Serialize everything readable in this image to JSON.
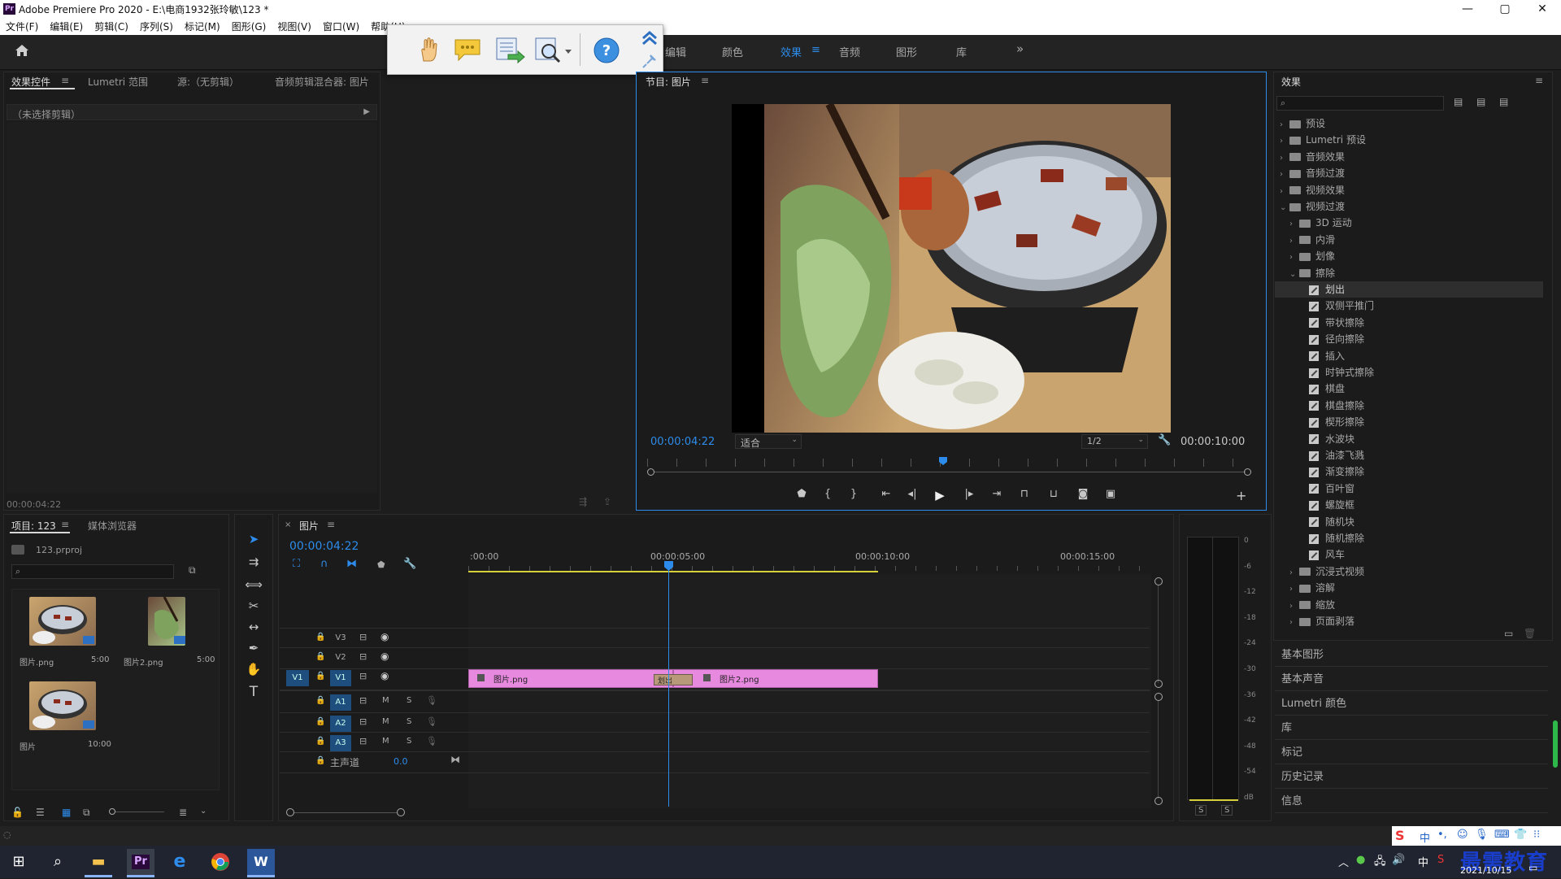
{
  "window": {
    "app_icon": "Pr",
    "title": "Adobe Premiere Pro 2020 - E:\\电商1932张玲敏\\123 *",
    "min": "—",
    "max": "▢",
    "close": "✕"
  },
  "menu": [
    "文件(F)",
    "编辑(E)",
    "剪辑(C)",
    "序列(S)",
    "标记(M)",
    "图形(G)",
    "视图(V)",
    "窗口(W)",
    "帮助(H)"
  ],
  "workspaces": [
    "编辑",
    "颜色",
    "效果",
    "音频",
    "图形",
    "库"
  ],
  "workspace_active": "效果",
  "workspace_more": "»",
  "effect_controls": {
    "tabs": [
      "效果控件",
      "Lumetri 范围",
      "源:（无剪辑）",
      "音频剪辑混合器: 图片"
    ],
    "no_clip": "（未选择剪辑）",
    "timecode": "00:00:04:22"
  },
  "program_monitor": {
    "title": "节目: 图片",
    "timecode": "00:00:04:22",
    "fit": "适合",
    "resolution": "1/2",
    "duration": "00:00:10:00",
    "playhead_fraction": 0.489
  },
  "project": {
    "tabs": [
      "项目: 123",
      "媒体浏览器"
    ],
    "file": "123.prproj",
    "items": [
      {
        "name": "图片.png",
        "duration": "5:00"
      },
      {
        "name": "图片2.png",
        "duration": "5:00"
      },
      {
        "name": "图片",
        "duration": "10:00"
      }
    ]
  },
  "timeline": {
    "tab": "图片",
    "timecode": "00:00:04:22",
    "ruler": [
      ":00:00",
      "00:00:05:00",
      "00:00:10:00",
      "00:00:15:00"
    ],
    "video_tracks": [
      "V3",
      "V2",
      "V1"
    ],
    "audio_tracks": [
      "A1",
      "A2",
      "A3"
    ],
    "source_patch": "V1",
    "master": "主声道",
    "master_value": "0.0",
    "clips": [
      {
        "name": "图片.png",
        "color": "#e889e0"
      },
      {
        "name": "图片2.png",
        "color": "#e889e0"
      }
    ],
    "transition": "划出",
    "track_buttons": {
      "m": "M",
      "s": "S"
    }
  },
  "audio_meter": {
    "scale": [
      "0",
      "-6",
      "-12",
      "-18",
      "-24",
      "-30",
      "-36",
      "-42",
      "-48",
      "-54",
      "dB"
    ],
    "solo": [
      "S",
      "S"
    ]
  },
  "effects": {
    "title": "效果",
    "tree": [
      {
        "label": "预设",
        "level": 0,
        "kind": "folder",
        "open": false
      },
      {
        "label": "Lumetri 预设",
        "level": 0,
        "kind": "folder",
        "open": false
      },
      {
        "label": "音频效果",
        "level": 0,
        "kind": "folder",
        "open": false
      },
      {
        "label": "音频过渡",
        "level": 0,
        "kind": "folder",
        "open": false
      },
      {
        "label": "视频效果",
        "level": 0,
        "kind": "folder",
        "open": false
      },
      {
        "label": "视频过渡",
        "level": 0,
        "kind": "folder",
        "open": true
      },
      {
        "label": "3D 运动",
        "level": 1,
        "kind": "folder",
        "open": false
      },
      {
        "label": "内滑",
        "level": 1,
        "kind": "folder",
        "open": false
      },
      {
        "label": "划像",
        "level": 1,
        "kind": "folder",
        "open": false
      },
      {
        "label": "擦除",
        "level": 1,
        "kind": "folder",
        "open": true
      },
      {
        "label": "划出",
        "level": 2,
        "kind": "fx",
        "selected": true
      },
      {
        "label": "双侧平推门",
        "level": 2,
        "kind": "fx"
      },
      {
        "label": "带状擦除",
        "level": 2,
        "kind": "fx"
      },
      {
        "label": "径向擦除",
        "level": 2,
        "kind": "fx"
      },
      {
        "label": "插入",
        "level": 2,
        "kind": "fx"
      },
      {
        "label": "时钟式擦除",
        "level": 2,
        "kind": "fx"
      },
      {
        "label": "棋盘",
        "level": 2,
        "kind": "fx"
      },
      {
        "label": "棋盘擦除",
        "level": 2,
        "kind": "fx"
      },
      {
        "label": "楔形擦除",
        "level": 2,
        "kind": "fx"
      },
      {
        "label": "水波块",
        "level": 2,
        "kind": "fx"
      },
      {
        "label": "油漆飞溅",
        "level": 2,
        "kind": "fx"
      },
      {
        "label": "渐变擦除",
        "level": 2,
        "kind": "fx"
      },
      {
        "label": "百叶窗",
        "level": 2,
        "kind": "fx"
      },
      {
        "label": "螺旋框",
        "level": 2,
        "kind": "fx"
      },
      {
        "label": "随机块",
        "level": 2,
        "kind": "fx"
      },
      {
        "label": "随机擦除",
        "level": 2,
        "kind": "fx"
      },
      {
        "label": "风车",
        "level": 2,
        "kind": "fx"
      },
      {
        "label": "沉浸式视频",
        "level": 1,
        "kind": "folder",
        "open": false
      },
      {
        "label": "溶解",
        "level": 1,
        "kind": "folder",
        "open": false
      },
      {
        "label": "缩放",
        "level": 1,
        "kind": "folder",
        "open": false
      },
      {
        "label": "页面剥落",
        "level": 1,
        "kind": "folder",
        "open": false
      }
    ],
    "collapsed_panels": [
      "基本图形",
      "基本声音",
      "Lumetri 颜色",
      "库",
      "标记",
      "历史记录",
      "信息"
    ]
  },
  "overlay_toolbar": [
    "hand-icon",
    "comment-icon",
    "export-icon",
    "search-zoom-icon",
    "help-icon"
  ],
  "taskbar": {
    "date": "2021/10/15",
    "watermark": "最需教育",
    "ime": "中"
  },
  "colors": {
    "accent": "#2d8ceb",
    "clip": "#e889e0",
    "playhead": "#2d8ceb",
    "work_area": "#d8d03a"
  }
}
